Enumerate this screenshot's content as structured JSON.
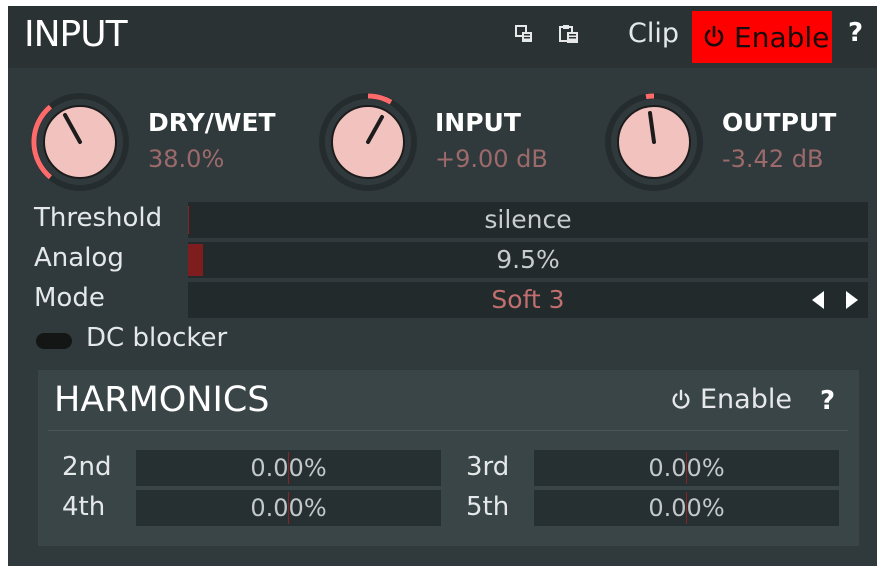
{
  "header": {
    "title": "INPUT",
    "copy_icon": "copy-icon",
    "paste_icon": "paste-icon",
    "clip_label": "Clip",
    "enable_label": "Enable",
    "help_label": "?"
  },
  "knobs": [
    {
      "name": "DRY/WET",
      "value": "38.0%"
    },
    {
      "name": "INPUT",
      "value": "+9.00 dB"
    },
    {
      "name": "OUTPUT",
      "value": "-3.42 dB"
    }
  ],
  "params": {
    "threshold": {
      "label": "Threshold",
      "value": "silence"
    },
    "analog": {
      "label": "Analog",
      "value": "9.5%"
    },
    "mode": {
      "label": "Mode",
      "value": "Soft 3"
    }
  },
  "dc_blocker": {
    "label": "DC blocker",
    "enabled": false
  },
  "harmonics": {
    "title": "HARMONICS",
    "enable_label": "Enable",
    "help_label": "?",
    "items": [
      {
        "label": "2nd",
        "value": "0.00%"
      },
      {
        "label": "3rd",
        "value": "0.00%"
      },
      {
        "label": "4th",
        "value": "0.00%"
      },
      {
        "label": "5th",
        "value": "0.00%"
      }
    ]
  },
  "colors": {
    "panel": "#303a3d",
    "header": "#2a3234",
    "enable_active": "#ff0000",
    "knob_value": "#9c6a6a",
    "accent_arc": "#ff6b6b"
  }
}
